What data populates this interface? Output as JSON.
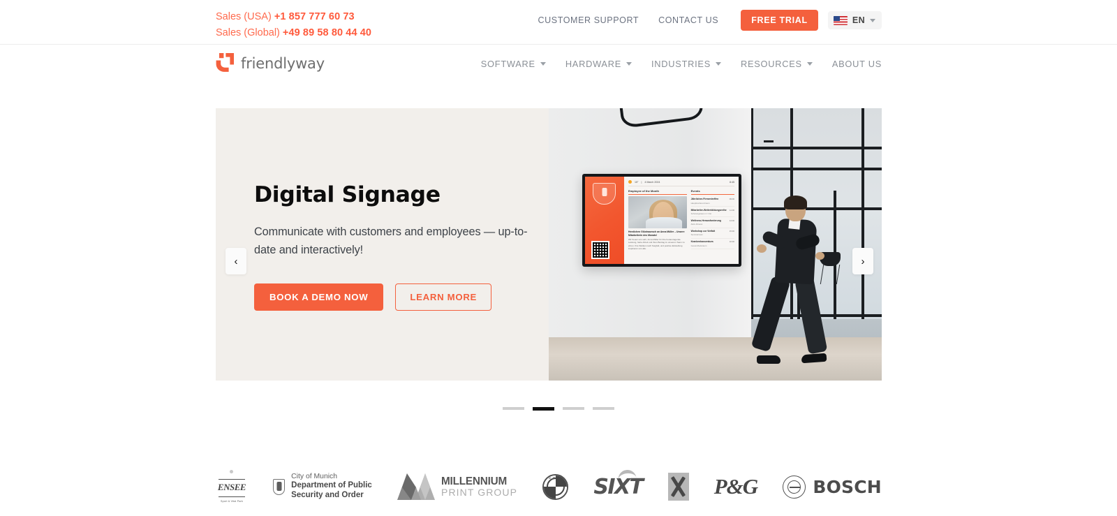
{
  "topbar": {
    "sales_usa_label": "Sales (USA)",
    "sales_usa_number": "+1 857 777 60 73",
    "sales_global_label": "Sales (Global)",
    "sales_global_number": "+49 89 58 80 44 40",
    "links": [
      {
        "label": "CUSTOMER SUPPORT",
        "name": "customer-support"
      },
      {
        "label": "CONTACT US",
        "name": "contact-us"
      }
    ],
    "free_trial_label": "FREE TRIAL",
    "language_code": "EN",
    "language_flag": "us-flag-icon",
    "accent_color": "#f4603d",
    "sales_color": "#ff6a4d"
  },
  "header": {
    "logo_text": "friendlyway",
    "logo_mark": "friendlyway-smile-icon",
    "nav": [
      {
        "label": "SOFTWARE",
        "has_dropdown": true
      },
      {
        "label": "HARDWARE",
        "has_dropdown": true
      },
      {
        "label": "INDUSTRIES",
        "has_dropdown": true
      },
      {
        "label": "RESOURCES",
        "has_dropdown": true
      },
      {
        "label": "ABOUT US",
        "has_dropdown": false
      }
    ]
  },
  "hero": {
    "title": "Digital Signage",
    "subtitle": "Communicate with customers and employees — up-to-date and interactively!",
    "primary_button": "BOOK A DEMO NOW",
    "secondary_button": "LEARN MORE",
    "prev_arrow": "‹",
    "next_arrow": "›",
    "background_color": "#f2efeb",
    "slides_total": 4,
    "active_slide": 2,
    "image_alt": "Businessman walking past a wall-mounted digital signage screen in an office"
  },
  "signage_screen": {
    "temperature": "15°",
    "date": "4 March 2024",
    "time": "8:45",
    "left_heading": "Employee of the Month",
    "left_caption_title": "Herzlichen Glückwunsch an Anna Müller – Unsere Mitarbeiterin des Monats!",
    "left_caption_text": "Wir freuen uns sehr, Anna Müller für ihre herausragende Leistung, harte Arbeit und ihren Beitrag zu unserem Team zu ehren. Ihre Stärken nach Sorgfalt, und positive Einstellung inspirieren uns alle.",
    "right_heading": "Events",
    "events": [
      {
        "title": "Jährliches Firmentreffen",
        "subtitle": "Hauptkonferenzraum",
        "time": "09:00"
      },
      {
        "title": "Mitarbeiter-Weiterbildungsreihe",
        "subtitle": "Schulungsraum 2 / Ost",
        "time": "11:00"
      },
      {
        "title": "Wellness-Herausforderung",
        "subtitle": "Aktiv-Fitness",
        "time": "14:00"
      },
      {
        "title": "Workshop zur Vielfalt",
        "subtitle": "Seminarraum",
        "time": "15:30"
      },
      {
        "title": "Krankenkassenkurs",
        "subtitle": "Gesundheitsraum",
        "time": "16:30"
      }
    ]
  },
  "clients": [
    {
      "name": "ensee",
      "title": "ENSEE",
      "subtitle": "Sport & Vital Park"
    },
    {
      "name": "munich",
      "line1": "City of Munich",
      "line2": "Department of Public",
      "line3": "Security and Order"
    },
    {
      "name": "millennium",
      "line1": "MILLENNIUM",
      "line2": "PRINT GROUP"
    },
    {
      "name": "bmw",
      "title": "BMW"
    },
    {
      "name": "sixt",
      "title": "SIXT"
    },
    {
      "name": "kaufland",
      "title": "Kaufland"
    },
    {
      "name": "pg",
      "title": "P&G"
    },
    {
      "name": "bosch",
      "title": "BOSCH"
    }
  ]
}
